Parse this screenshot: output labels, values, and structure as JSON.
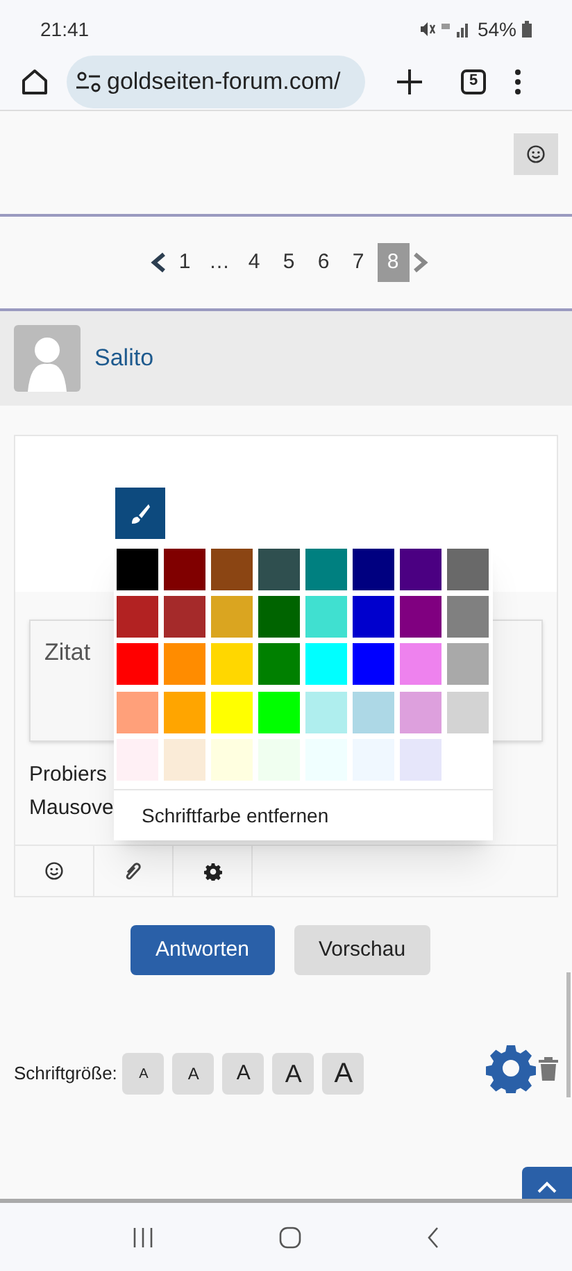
{
  "status_bar": {
    "time": "21:41",
    "battery": "54%"
  },
  "browser": {
    "url": "goldseiten-forum.com/",
    "tab_count": "5"
  },
  "pagination": {
    "pages": [
      {
        "label": "1",
        "selected": false
      },
      {
        "label": "…",
        "selected": false
      },
      {
        "label": "4",
        "selected": false
      },
      {
        "label": "5",
        "selected": false
      },
      {
        "label": "6",
        "selected": false
      },
      {
        "label": "7",
        "selected": false
      },
      {
        "label": "8",
        "selected": true
      }
    ]
  },
  "post": {
    "author": "Salito"
  },
  "editor": {
    "quote_title": "Zitat",
    "text_lines": [
      "Probiers",
      "Mausove"
    ]
  },
  "color_picker": {
    "colors": [
      {
        "color": "#000000"
      },
      {
        "color": "#800000"
      },
      {
        "color": "#8b4513"
      },
      {
        "color": "#2f4f4f"
      },
      {
        "color": "#008080"
      },
      {
        "color": "#000080"
      },
      {
        "color": "#4b0082"
      },
      {
        "color": "#696969"
      },
      {
        "color": "#b22222"
      },
      {
        "color": "#a52a2a"
      },
      {
        "color": "#daa520"
      },
      {
        "color": "#006400"
      },
      {
        "color": "#40e0d0"
      },
      {
        "color": "#0000cd"
      },
      {
        "color": "#800080"
      },
      {
        "color": "#808080"
      },
      {
        "color": "#ff0000"
      },
      {
        "color": "#ff8c00"
      },
      {
        "color": "#ffd700"
      },
      {
        "color": "#008000"
      },
      {
        "color": "#00ffff"
      },
      {
        "color": "#0000ff"
      },
      {
        "color": "#ee82ee"
      },
      {
        "color": "#a9a9a9"
      },
      {
        "color": "#ffa07a"
      },
      {
        "color": "#ffa500"
      },
      {
        "color": "#ffff00"
      },
      {
        "color": "#00ff00"
      },
      {
        "color": "#afeeee"
      },
      {
        "color": "#add8e6"
      },
      {
        "color": "#dda0dd"
      },
      {
        "color": "#d3d3d3"
      },
      {
        "color": "#fff0f5"
      },
      {
        "color": "#faebd7"
      },
      {
        "color": "#ffffe0"
      },
      {
        "color": "#f0fff0"
      },
      {
        "color": "#f0ffff"
      },
      {
        "color": "#f0f8ff"
      },
      {
        "color": "#e6e6fa"
      }
    ],
    "remove_label": "Schriftfarbe entfernen"
  },
  "buttons": [
    {
      "label": "Antworten",
      "kind": "primary"
    },
    {
      "label": "Vorschau",
      "kind": "secondary"
    }
  ],
  "font_size": {
    "label": "Schriftgröße:",
    "options": [
      "A",
      "A",
      "A",
      "A",
      "A"
    ]
  }
}
